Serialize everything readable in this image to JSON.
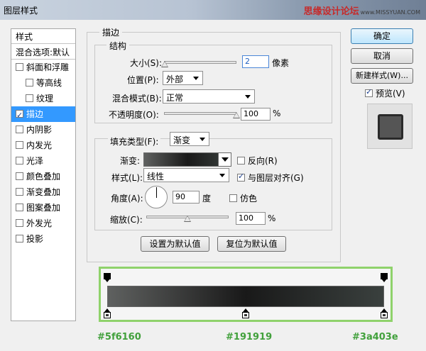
{
  "window": {
    "title": "图层样式",
    "watermark": "思缘设计论坛",
    "watermark_url": "www.MISSYUAN.COM"
  },
  "styles": {
    "header": "样式",
    "blend_options": "混合选项:默认",
    "items": [
      {
        "label": "斜面和浮雕",
        "checked": false,
        "sub": false
      },
      {
        "label": "等高线",
        "checked": false,
        "sub": true
      },
      {
        "label": "纹理",
        "checked": false,
        "sub": true
      },
      {
        "label": "描边",
        "checked": true,
        "sub": false,
        "selected": true
      },
      {
        "label": "内阴影",
        "checked": false,
        "sub": false
      },
      {
        "label": "内发光",
        "checked": false,
        "sub": false
      },
      {
        "label": "光泽",
        "checked": false,
        "sub": false
      },
      {
        "label": "颜色叠加",
        "checked": false,
        "sub": false
      },
      {
        "label": "渐变叠加",
        "checked": false,
        "sub": false
      },
      {
        "label": "图案叠加",
        "checked": false,
        "sub": false
      },
      {
        "label": "外发光",
        "checked": false,
        "sub": false
      },
      {
        "label": "投影",
        "checked": false,
        "sub": false
      }
    ]
  },
  "stroke": {
    "group_title": "描边",
    "structure_title": "结构",
    "size_label": "大小(S):",
    "size_value": "2",
    "size_unit": "像素",
    "size_slider": 0.01,
    "position_label": "位置(P):",
    "position_value": "外部",
    "blend_label": "混合模式(B):",
    "blend_value": "正常",
    "opacity_label": "不透明度(O):",
    "opacity_value": "100",
    "opacity_unit": "%",
    "opacity_slider": 1.0,
    "fill_type_label": "填充类型(F):",
    "fill_type_value": "渐变",
    "gradient_label": "渐变:",
    "reverse_label": "反向(R)",
    "reverse_checked": false,
    "style_label": "样式(L):",
    "style_value": "线性",
    "align_label": "与图层对齐(G)",
    "align_checked": true,
    "angle_label": "角度(A):",
    "angle_value": "90",
    "angle_unit": "度",
    "dither_label": "仿色",
    "dither_checked": false,
    "scale_label": "缩放(C):",
    "scale_value": "100",
    "scale_unit": "%",
    "scale_slider": 0.5,
    "set_default": "设置为默认值",
    "reset_default": "复位为默认值"
  },
  "buttons": {
    "ok": "确定",
    "cancel": "取消",
    "new_style": "新建样式(W)...",
    "preview_label": "预览(V)",
    "preview_checked": true
  },
  "gradient_editor": {
    "colors": [
      "#5f6160",
      "#191919",
      "#3a403e"
    ],
    "labels": [
      "#5f6160",
      "#191919",
      "#3a403e"
    ]
  }
}
